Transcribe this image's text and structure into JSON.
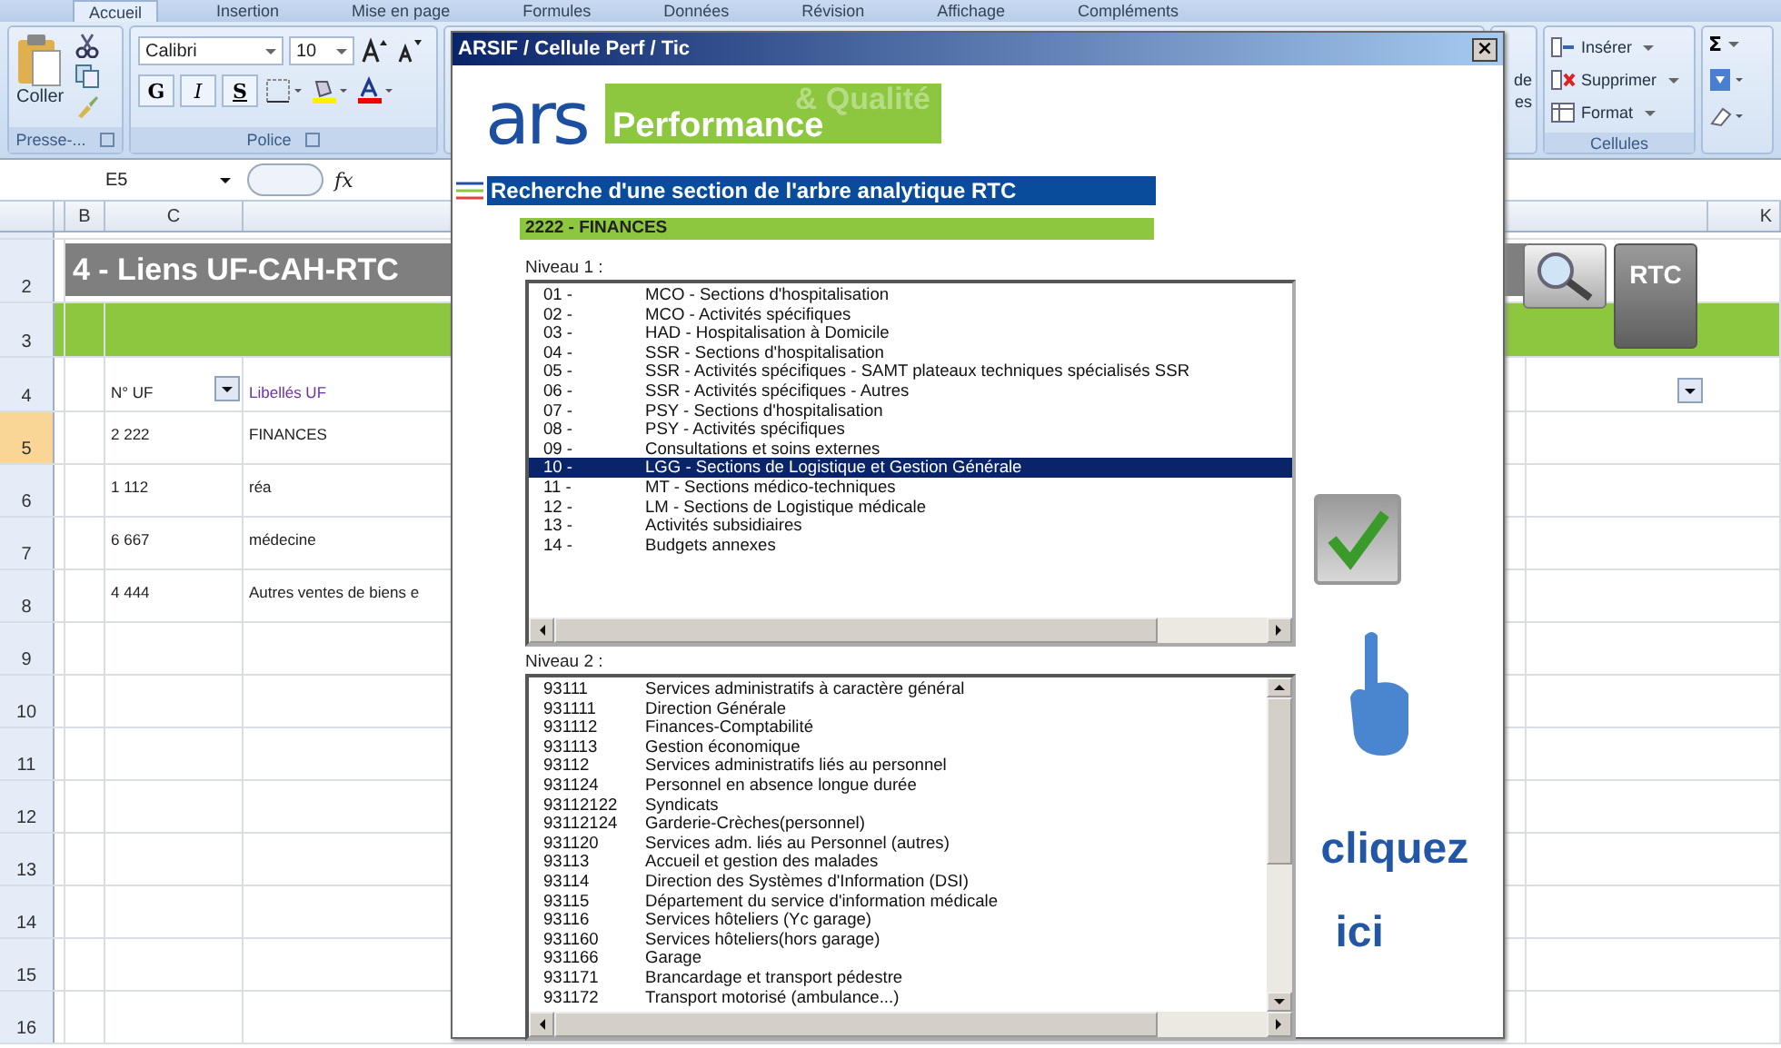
{
  "ribbon": {
    "tabs": [
      {
        "label": "Accueil",
        "selected": true
      },
      {
        "label": "Insertion",
        "selected": false
      },
      {
        "label": "Mise en page",
        "selected": false
      },
      {
        "label": "Formules",
        "selected": false
      },
      {
        "label": "Données",
        "selected": false
      },
      {
        "label": "Révision",
        "selected": false
      },
      {
        "label": "Affichage",
        "selected": false
      },
      {
        "label": "Compléments",
        "selected": false
      }
    ],
    "clipboard": {
      "paste": "Coller",
      "group": "Presse-..."
    },
    "font": {
      "name": "Calibri",
      "size": "10",
      "bold": "G",
      "italic": "I",
      "underline": "S",
      "group": "Police"
    },
    "partial_group": [
      "de",
      "es"
    ],
    "cells": {
      "items": [
        {
          "label": "Insérer",
          "kind": "insert"
        },
        {
          "label": "Supprimer",
          "kind": "delete"
        },
        {
          "label": "Format",
          "kind": "format"
        }
      ],
      "group": "Cellules"
    },
    "editing": {
      "sum": "Σ"
    }
  },
  "formula_bar": {
    "name_box": "E5",
    "fx": "fx"
  },
  "sheet": {
    "columns": [
      "B",
      "C",
      "K"
    ],
    "rows": [
      {
        "number": "2",
        "selected": false,
        "kind": "title",
        "text": "4 - Liens UF-CAH-RTC"
      },
      {
        "number": "3",
        "selected": false,
        "kind": "band"
      },
      {
        "number": "4",
        "selected": false,
        "kind": "header",
        "uf": "N° UF",
        "label": "Libellés UF"
      },
      {
        "number": "5",
        "selected": true,
        "kind": "data",
        "uf": "2 222",
        "label": "FINANCES"
      },
      {
        "number": "6",
        "selected": false,
        "kind": "data",
        "uf": "1 112",
        "label": "réa"
      },
      {
        "number": "7",
        "selected": false,
        "kind": "data",
        "uf": "6 667",
        "label": "médecine"
      },
      {
        "number": "8",
        "selected": false,
        "kind": "data",
        "uf": "4 444",
        "label": "Autres ventes de biens e"
      },
      {
        "number": "9",
        "selected": false,
        "kind": "empty"
      },
      {
        "number": "10",
        "selected": false,
        "kind": "empty"
      },
      {
        "number": "11",
        "selected": false,
        "kind": "empty"
      },
      {
        "number": "12",
        "selected": false,
        "kind": "empty"
      },
      {
        "number": "13",
        "selected": false,
        "kind": "empty"
      },
      {
        "number": "14",
        "selected": false,
        "kind": "empty"
      },
      {
        "number": "15",
        "selected": false,
        "kind": "empty"
      },
      {
        "number": "16",
        "selected": false,
        "kind": "empty"
      }
    ],
    "rtc_button": "RTC"
  },
  "dialog": {
    "title": "ARSIF / Cellule Perf / Tic",
    "close": "×",
    "logo": {
      "mark": "ars",
      "banner": "Performance",
      "banner_faded": "& Qualité"
    },
    "heading": "Recherche d'une section de l'arbre analytique RTC",
    "section": "2222 - FINANCES",
    "level1": {
      "label": "Niveau 1 :",
      "items": [
        {
          "code": "01 -",
          "name": "MCO - Sections d'hospitalisation",
          "selected": false
        },
        {
          "code": "02 -",
          "name": "MCO - Activités spécifiques",
          "selected": false
        },
        {
          "code": "03 -",
          "name": "HAD - Hospitalisation à Domicile",
          "selected": false
        },
        {
          "code": "04 -",
          "name": "SSR - Sections d'hospitalisation",
          "selected": false
        },
        {
          "code": "05 -",
          "name": "SSR - Activités spécifiques - SAMT plateaux techniques spécialisés SSR",
          "selected": false
        },
        {
          "code": "06 -",
          "name": "SSR - Activités spécifiques - Autres",
          "selected": false
        },
        {
          "code": "07 -",
          "name": "PSY - Sections d'hospitalisation",
          "selected": false
        },
        {
          "code": "08 -",
          "name": "PSY - Activités spécifiques",
          "selected": false
        },
        {
          "code": "09 -",
          "name": "Consultations et soins externes",
          "selected": false
        },
        {
          "code": "10 -",
          "name": "LGG - Sections de  Logistique et Gestion Générale",
          "selected": true
        },
        {
          "code": "11 -",
          "name": "MT - Sections médico-techniques",
          "selected": false
        },
        {
          "code": "12 -",
          "name": "LM - Sections de Logistique médicale",
          "selected": false
        },
        {
          "code": "13 -",
          "name": "Activités subsidiaires",
          "selected": false
        },
        {
          "code": "14 -",
          "name": "Budgets annexes",
          "selected": false
        }
      ]
    },
    "level2": {
      "label": "Niveau 2 :",
      "items": [
        {
          "code": "93111",
          "name": "Services administratifs à caractère général"
        },
        {
          "code": "931111",
          "name": "Direction Générale"
        },
        {
          "code": "931112",
          "name": "Finances-Comptabilité"
        },
        {
          "code": "931113",
          "name": "Gestion économique"
        },
        {
          "code": "93112",
          "name": "Services administratifs liés au personnel"
        },
        {
          "code": "931124",
          "name": "Personnel en absence longue durée"
        },
        {
          "code": "93112122",
          "name": "Syndicats"
        },
        {
          "code": "93112124",
          "name": "Garderie-Crèches(personnel)"
        },
        {
          "code": "931120",
          "name": "Services adm. liés au Personnel (autres)"
        },
        {
          "code": "93113",
          "name": "Accueil et gestion des malades"
        },
        {
          "code": "93114",
          "name": "Direction des Systèmes d'Information (DSI)"
        },
        {
          "code": "93115",
          "name": "Département du service d'information médicale"
        },
        {
          "code": "93116",
          "name": "Services hôteliers (Yc garage)"
        },
        {
          "code": "931160",
          "name": "Services hôteliers(hors garage)"
        },
        {
          "code": "931166",
          "name": "Garage"
        },
        {
          "code": "931171",
          "name": "Brancardage et transport pédestre"
        },
        {
          "code": "931172",
          "name": "Transport motorisé (ambulance...)"
        }
      ]
    },
    "hint": [
      "cliquez",
      "ici"
    ]
  }
}
